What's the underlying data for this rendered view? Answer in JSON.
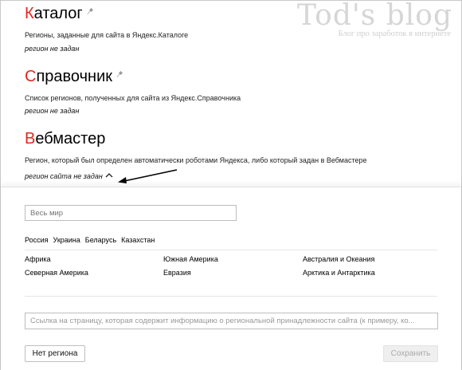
{
  "watermark": {
    "title": "Tod's blog",
    "subtitle": "Блог про заработок в интернете"
  },
  "catalog": {
    "title_first": "К",
    "title_rest": "аталог",
    "description": "Регионы, заданные для сайта в Яндекс.Каталоге",
    "status": "регион не задан"
  },
  "directory": {
    "title_first": "С",
    "title_rest": "правочник",
    "description": "Список регионов, полученных для сайта из Яндекс.Справочника",
    "status": "регион не задан"
  },
  "webmaster": {
    "title_first": "В",
    "title_rest": "ебмастер",
    "description": "Регион, который был определен автоматически роботами Яндекса, либо который задан в Вебмастере",
    "status": "регион сайта не задан"
  },
  "panel": {
    "search_placeholder": "Весь мир",
    "quick_regions": [
      "Россия",
      "Украина",
      "Беларусь",
      "Казахстан"
    ],
    "regions": {
      "col1": [
        "Африка",
        "Северная Америка"
      ],
      "col2": [
        "Южная Америка",
        "Евразия"
      ],
      "col3": [
        "Австралия и Океания",
        "Арктика и Антарктика"
      ]
    },
    "link_placeholder": "Ссылка на страницу, которая содержит информацию о региональной принадлежности сайта (к примеру, ко...",
    "no_region_label": "Нет региона",
    "save_label": "Сохранить"
  },
  "colors": {
    "accent_red": "#e52620",
    "arrow": "#000000"
  }
}
